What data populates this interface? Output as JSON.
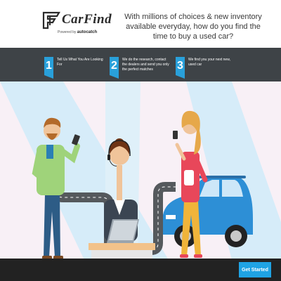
{
  "header": {
    "logo_text": "CarFind",
    "powered_by": "Powered by",
    "powered_brand": "autocatch",
    "tagline": "With millions of choices & new inventory available everyday, how do you find the time to buy a used car?"
  },
  "steps": [
    {
      "number": "1",
      "text": "Tell Us What You Are Looking For"
    },
    {
      "number": "2",
      "text": "We do the research, contact the dealers and send you only the perfect matches"
    },
    {
      "number": "3",
      "text": "We find you your next new, used car"
    }
  ],
  "cta": {
    "label": "Get Started"
  },
  "colors": {
    "accent": "#29a0da",
    "steps_bg": "#3e4347",
    "scene_bg": "#f8f0f6",
    "footer_bg": "#222222",
    "car": "#2d8fd6"
  }
}
